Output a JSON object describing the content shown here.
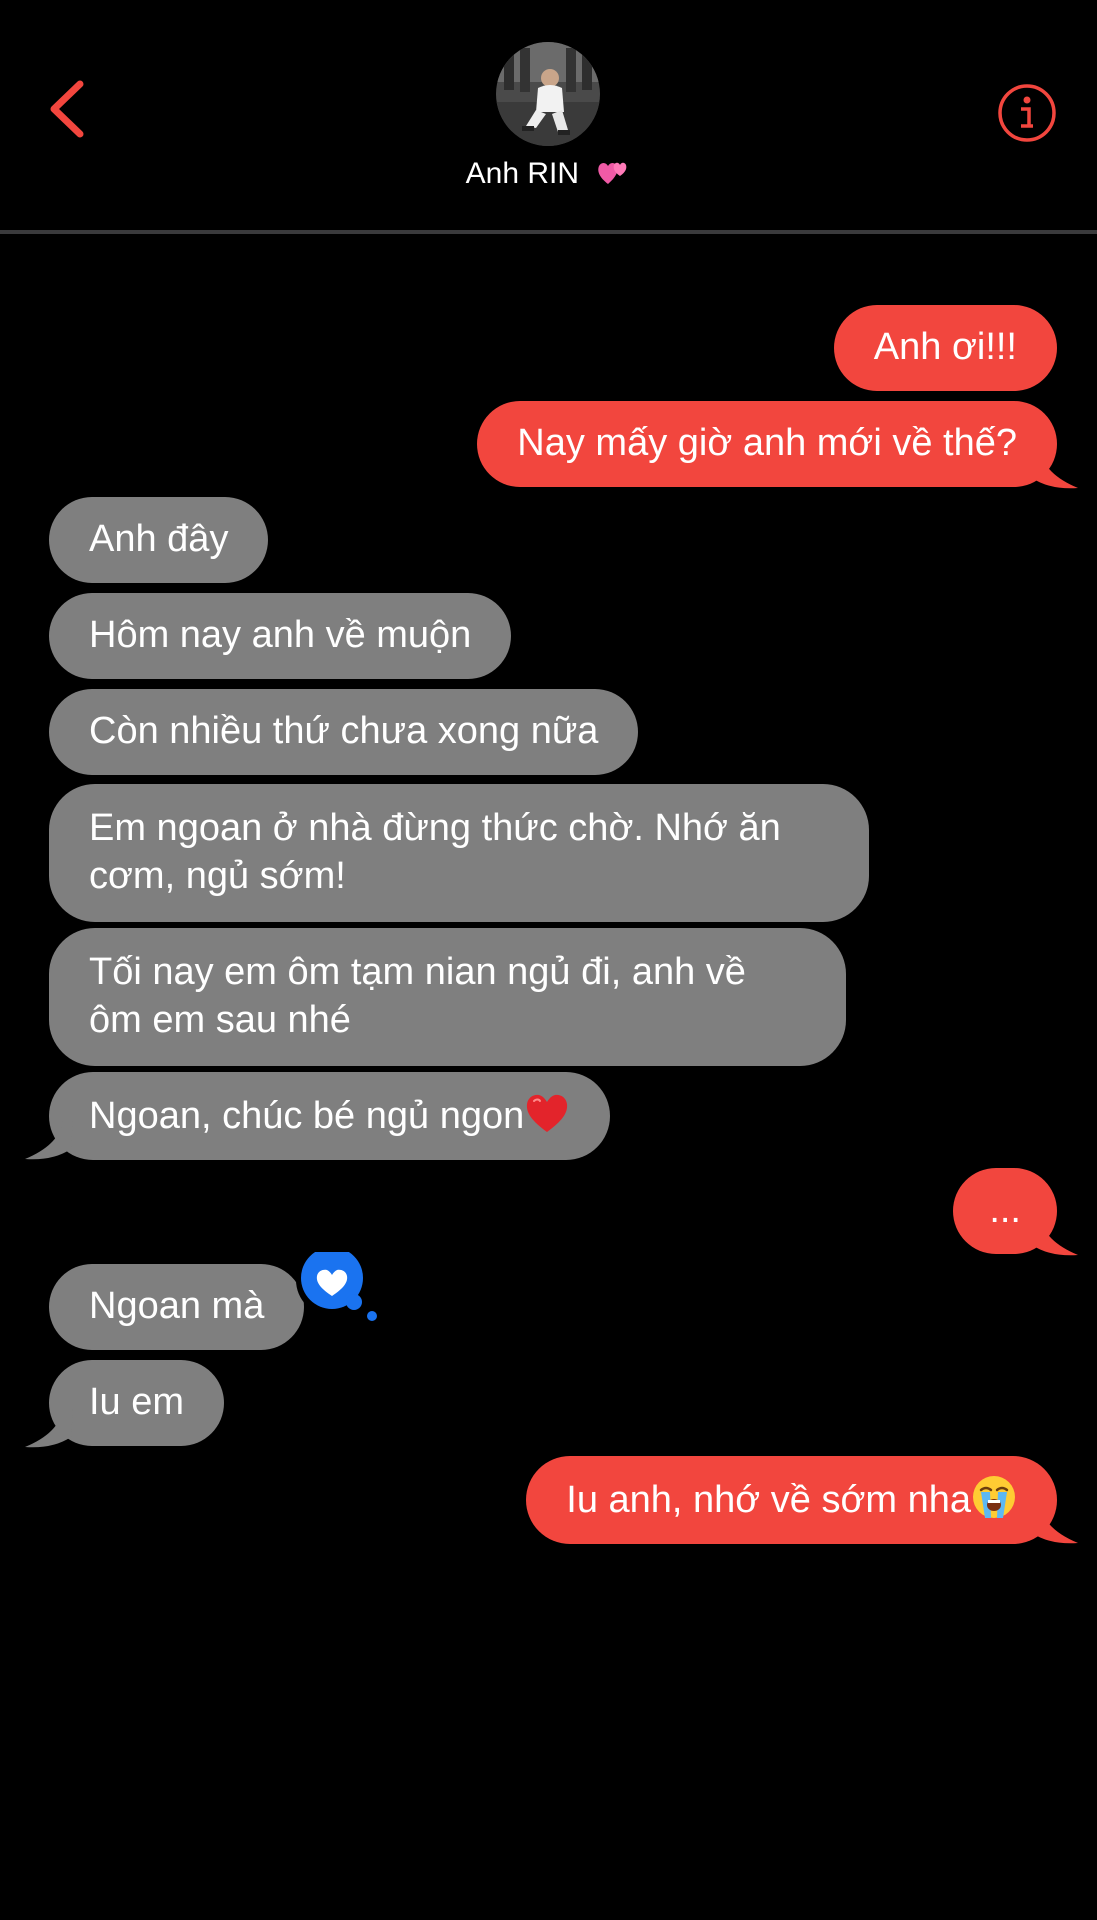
{
  "header": {
    "contact_name": "Anh RIN",
    "contact_emoji": "two-hearts-emoji",
    "back_icon": "chevron-left-icon",
    "info_icon": "info-icon",
    "accent_color": "#f2463e"
  },
  "messages": [
    {
      "from": "me",
      "text": "Anh ơi!!!"
    },
    {
      "from": "me",
      "text": "Nay mấy giờ anh mới về thế?"
    },
    {
      "from": "them",
      "text": "Anh đây"
    },
    {
      "from": "them",
      "text": "Hôm nay anh về muộn"
    },
    {
      "from": "them",
      "text": "Còn nhiều thứ chưa xong nữa"
    },
    {
      "from": "them",
      "text": "Em ngoan ở nhà đừng thức chờ. Nhớ ăn cơm, ngủ sớm!"
    },
    {
      "from": "them",
      "text": "Tối nay em ôm tạm nian ngủ đi, anh về ôm em sau nhé"
    },
    {
      "from": "them",
      "text": "Ngoan, chúc bé ngủ ngon",
      "emoji": "red-heart-emoji"
    },
    {
      "from": "me",
      "text": "..."
    },
    {
      "from": "them",
      "text": "Ngoan mà",
      "reaction": "heart-reaction-icon"
    },
    {
      "from": "them",
      "text": "Iu em"
    },
    {
      "from": "me",
      "text": "Iu anh, nhớ về sớm nha",
      "emoji": "loudly-crying-face-emoji"
    }
  ],
  "colors": {
    "sent_bubble": "#f2463e",
    "received_bubble": "#7f7f7f",
    "background": "#000000",
    "reaction": "#1a73f0"
  }
}
